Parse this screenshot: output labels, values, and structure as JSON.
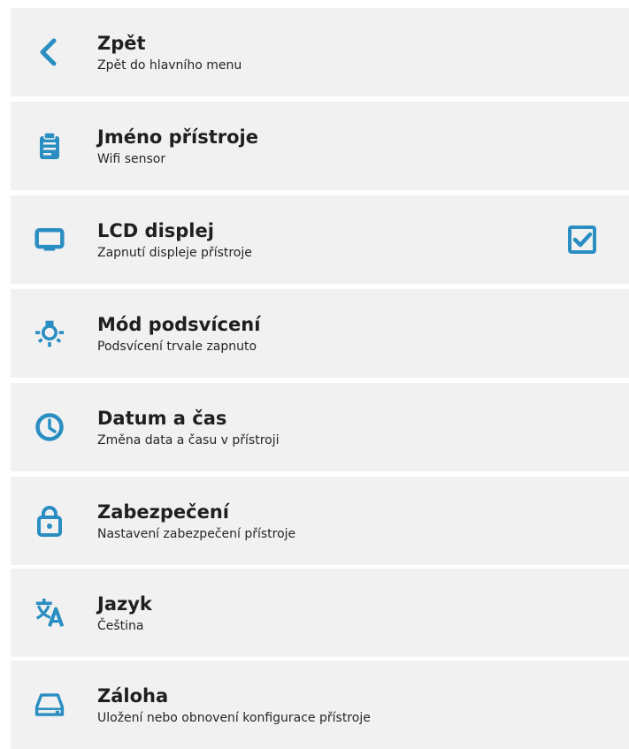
{
  "accent_color": "#2a8ec2",
  "menu": {
    "items": [
      {
        "icon": "chevron-left-icon",
        "title": "Zpět",
        "subtitle": "Zpět do hlavního menu"
      },
      {
        "icon": "clipboard-icon",
        "title": "Jméno přístroje",
        "subtitle": "Wifi sensor"
      },
      {
        "icon": "monitor-icon",
        "title": "LCD displej",
        "subtitle": "Zapnutí displeje přístroje",
        "checked": true
      },
      {
        "icon": "backlight-bulb-icon",
        "title": "Mód podsvícení",
        "subtitle": "Podsvícení trvale zapnuto"
      },
      {
        "icon": "clock-icon",
        "title": "Datum a čas",
        "subtitle": "Změna data a času v přístroji"
      },
      {
        "icon": "lock-icon",
        "title": "Zabezpečení",
        "subtitle": "Nastavení zabezpečení přístroje"
      },
      {
        "icon": "translate-icon",
        "title": "Jazyk",
        "subtitle": "Čeština"
      },
      {
        "icon": "drive-icon",
        "title": "Záloha",
        "subtitle": "Uložení nebo obnovení konfigurace přístroje"
      }
    ]
  }
}
